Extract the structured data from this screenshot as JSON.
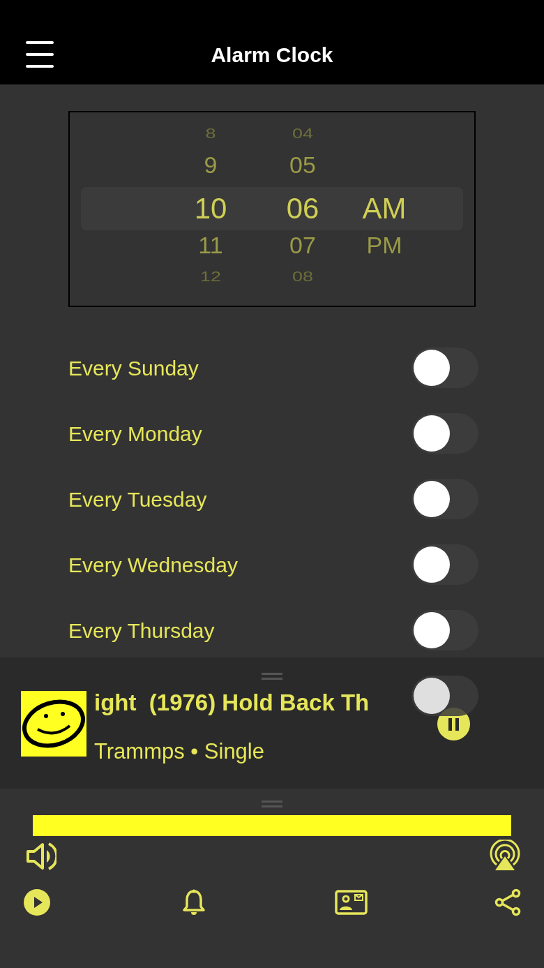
{
  "header": {
    "title": "Alarm Clock"
  },
  "picker": {
    "columns": [
      {
        "items": [
          {
            "label": "8",
            "selected": false
          },
          {
            "label": "9",
            "selected": false
          },
          {
            "label": "10",
            "selected": true
          },
          {
            "label": "11",
            "selected": false
          },
          {
            "label": "12",
            "selected": false
          }
        ]
      },
      {
        "items": [
          {
            "label": "04",
            "selected": false
          },
          {
            "label": "05",
            "selected": false
          },
          {
            "label": "06",
            "selected": true
          },
          {
            "label": "07",
            "selected": false
          },
          {
            "label": "08",
            "selected": false
          }
        ]
      },
      {
        "items": [
          {
            "label": "AM",
            "selected": true
          },
          {
            "label": "PM",
            "selected": false
          }
        ]
      }
    ]
  },
  "repeat_days": [
    {
      "label": "Every Sunday",
      "on": false
    },
    {
      "label": "Every Monday",
      "on": false
    },
    {
      "label": "Every Tuesday",
      "on": false
    },
    {
      "label": "Every Wednesday",
      "on": false
    },
    {
      "label": "Every Thursday",
      "on": false
    },
    {
      "on": false
    }
  ],
  "now_playing": {
    "title": "ight  (1976) Hold Back Th",
    "subtitle": "Trammps • Single",
    "playing": true
  },
  "volume": {
    "level": 1
  }
}
